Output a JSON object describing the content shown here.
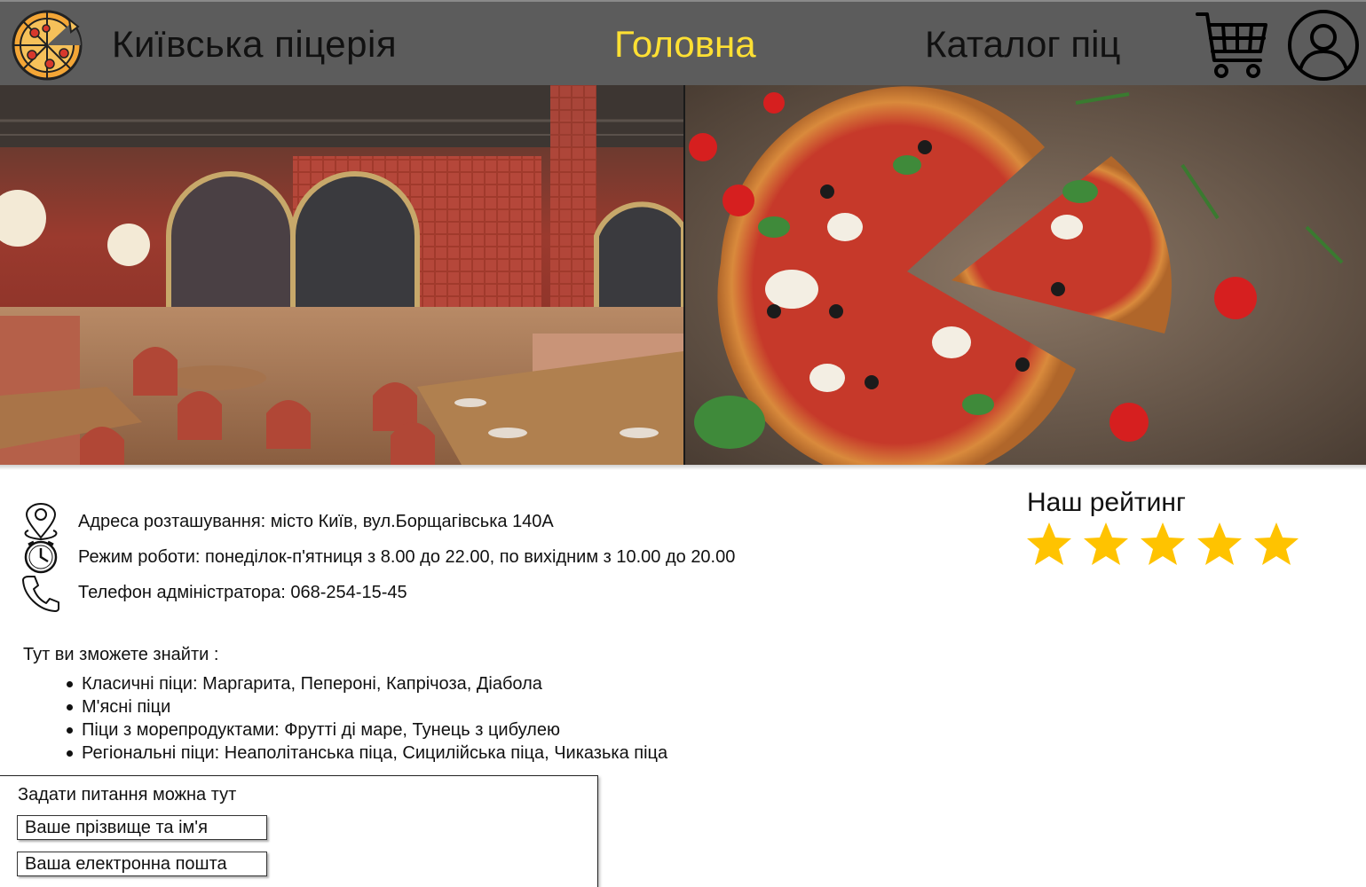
{
  "header": {
    "title": "Київська піцерія",
    "nav": {
      "home": "Головна",
      "catalog": "Каталог піц"
    },
    "logo_icon": "pizza-logo-icon",
    "cart_icon": "shopping-cart-icon",
    "user_icon": "user-account-icon"
  },
  "colors": {
    "header_bg": "#5c5c5c",
    "nav_active": "#ffe033",
    "star": "#ffc300"
  },
  "hero": {
    "left_image": "restaurant-interior-photo",
    "right_image": "pizza-photo"
  },
  "info": {
    "address": "Адреса розташування: місто Київ, вул.Борщагівська 140А",
    "hours": "Режим роботи: понеділок-п'ятниця з 8.00 до 22.00, по вихідним з 10.00 до 20.00",
    "phone": "Телефон адміністратора: 068-254-15-45"
  },
  "rating": {
    "title": "Наш рейтинг",
    "stars": 5,
    "max": 5
  },
  "features": {
    "intro": "Тут ви зможете знайти :",
    "items": [
      "Класичні піци: Маргарита, Пепероні, Капрічоза, Діабола",
      "М'ясні піци",
      "Піци з морепродуктами: Фрутті ді маре, Тунець з цибулею",
      "Регіональні піци: Неаполітанська піца, Сицилійська піца, Чиказька піца"
    ]
  },
  "form": {
    "title": "Задати питання можна тут",
    "name_placeholder": "Ваше прізвище та ім'я",
    "email_placeholder": "Ваша електронна пошта"
  }
}
